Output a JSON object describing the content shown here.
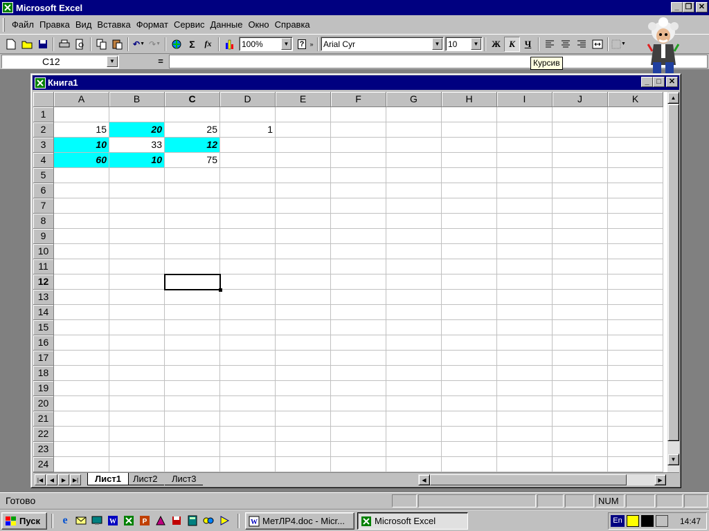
{
  "app": {
    "title": "Microsoft Excel"
  },
  "menu": [
    "Файл",
    "Правка",
    "Вид",
    "Вставка",
    "Формат",
    "Сервис",
    "Данные",
    "Окно",
    "Справка"
  ],
  "toolbar": {
    "zoom": "100%",
    "font_name": "Arial Cyr",
    "font_size": "10",
    "bold_label": "Ж",
    "italic_label": "К",
    "underline_label": "Ч",
    "sigma_label": "Σ",
    "fx_label": "fx",
    "help_label": "?"
  },
  "formula_bar": {
    "name_box": "C12",
    "equals": "=",
    "content": ""
  },
  "tooltip": {
    "text": "Курсив"
  },
  "workbook": {
    "title": "Книга1"
  },
  "columns": [
    "A",
    "B",
    "C",
    "D",
    "E",
    "F",
    "G",
    "H",
    "I",
    "J",
    "K"
  ],
  "rows": [
    "1",
    "2",
    "3",
    "4",
    "5",
    "6",
    "7",
    "8",
    "9",
    "10",
    "11",
    "12",
    "13",
    "14",
    "15",
    "16",
    "17",
    "18",
    "19",
    "20",
    "21",
    "22",
    "23",
    "24"
  ],
  "active_column": "C",
  "active_row": "12",
  "cells": [
    {
      "ref": "A2",
      "value": "15",
      "fill": "",
      "bold_italic": false
    },
    {
      "ref": "B2",
      "value": "20",
      "fill": "#00ffff",
      "bold_italic": true
    },
    {
      "ref": "C2",
      "value": "25",
      "fill": "",
      "bold_italic": false
    },
    {
      "ref": "D2",
      "value": "1",
      "fill": "",
      "bold_italic": false
    },
    {
      "ref": "A3",
      "value": "10",
      "fill": "#00ffff",
      "bold_italic": true
    },
    {
      "ref": "B3",
      "value": "33",
      "fill": "",
      "bold_italic": false
    },
    {
      "ref": "C3",
      "value": "12",
      "fill": "#00ffff",
      "bold_italic": true
    },
    {
      "ref": "A4",
      "value": "60",
      "fill": "#00ffff",
      "bold_italic": true
    },
    {
      "ref": "B4",
      "value": "10",
      "fill": "#00ffff",
      "bold_italic": true
    },
    {
      "ref": "C4",
      "value": "75",
      "fill": "",
      "bold_italic": false
    }
  ],
  "sheets": [
    {
      "name": "Лист1",
      "active": true
    },
    {
      "name": "Лист2",
      "active": false
    },
    {
      "name": "Лист3",
      "active": false
    }
  ],
  "status": {
    "text": "Готово",
    "num": "NUM"
  },
  "taskbar": {
    "start_label": "Пуск",
    "tasks": [
      {
        "label": "МетЛР4.doc - Micr...",
        "active": false
      },
      {
        "label": "Microsoft Excel",
        "active": true
      }
    ],
    "lang": "En",
    "clock": "14:47"
  },
  "colors": {
    "title_bar": "#000080",
    "chrome": "#c0c0c0",
    "cell_highlight": "#00ffff"
  }
}
